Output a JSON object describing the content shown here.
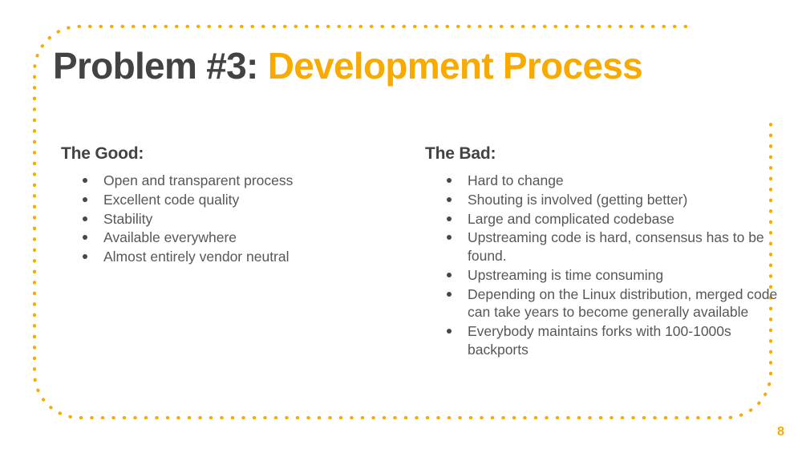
{
  "slide": {
    "background_color": "#ffffff",
    "accent_color": "#f9aa00",
    "heading_color": "#434343",
    "body_color": "#575757",
    "title": {
      "prefix": "Problem #3:",
      "highlight": " Development Process"
    },
    "page_number": "8",
    "columns": [
      {
        "heading": "The Good:",
        "bullets": [
          "Open and transparent process",
          "Excellent code quality",
          "Stability",
          "Available everywhere",
          "Almost entirely vendor neutral"
        ]
      },
      {
        "heading": "The Bad:",
        "bullets": [
          "Hard to change",
          "Shouting is involved (getting better)",
          "Large and complicated codebase",
          "Upstreaming code is hard, consensus has to be found.",
          "Upstreaming is time consuming",
          "Depending on the Linux distribution, merged code can take years to become generally available",
          "Everybody maintains forks with 100-1000s backports"
        ]
      }
    ]
  }
}
